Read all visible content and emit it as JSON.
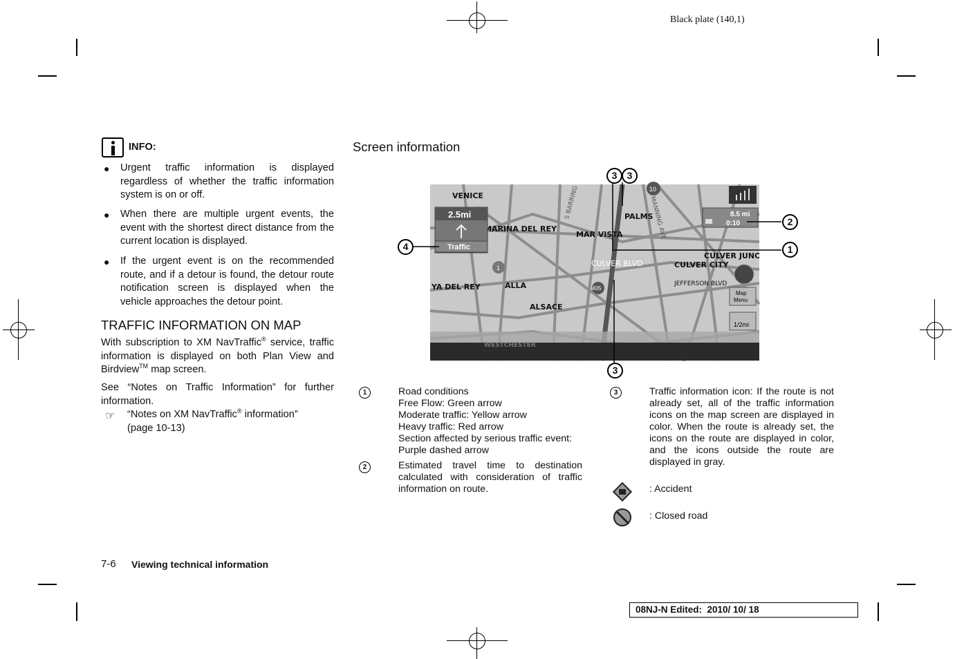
{
  "header": {
    "plate": "Black plate (140,1)"
  },
  "info": {
    "label": "INFO:",
    "bullets": [
      "Urgent traffic information is displayed regardless of whether the traffic information system is on or off.",
      "When there are multiple urgent events, the event with the shortest direct distance from the current location is displayed.",
      "If the urgent event is on the recommended route, and if a detour is found, the detour route notification screen is displayed when the vehicle approaches the detour point."
    ]
  },
  "traffic_section": {
    "heading": "TRAFFIC INFORMATION ON MAP",
    "para1_a": "With subscription to XM NavTraffic",
    "para1_reg": "®",
    "para1_b": " service, traffic information is displayed on both Plan View and Birdview",
    "para1_tm": "TM",
    "para1_c": " map screen.",
    "para2": "See “Notes on Traffic Information” for further information.",
    "ref_a": "“Notes on XM NavTraffic",
    "ref_reg": "®",
    "ref_b": " information”",
    "ref_page": "(page 10-13)"
  },
  "screen_info": {
    "heading": "Screen information",
    "map": {
      "places": [
        "VENICE",
        "MARINA DEL REY",
        "MAR VISTA",
        "PALMS",
        "CULVER BLVD",
        "CULVER JUNC",
        "CULVER CITY",
        "JEFFERSON BLVD",
        "YA DEL REY",
        "ALLA",
        "ALSACE",
        "WESTCHESTER",
        "MANNING AVE",
        "S BARRING"
      ],
      "shields": [
        "10",
        "1",
        "405"
      ],
      "distance_box": "2.5mi",
      "traffic_button": "Traffic",
      "dest_distance": "8.5 mi",
      "dest_time": "0:10",
      "map_menu_line1": "Map",
      "map_menu_line2": "Menu",
      "scale": "1/2mi",
      "callouts": [
        "1",
        "2",
        "3",
        "4"
      ]
    },
    "legend": [
      {
        "num": "1",
        "lines": [
          "Road conditions",
          "Free Flow: Green arrow",
          "Moderate traffic: Yellow arrow",
          "Heavy traffic: Red arrow",
          "Section affected by serious traffic event:",
          "Purple dashed arrow"
        ]
      },
      {
        "num": "2",
        "text": "Estimated travel time to destination calculated with consideration of traffic information on route."
      },
      {
        "num": "3",
        "text": "Traffic information icon: If the route is not already set, all of the traffic information icons on the map screen are displayed in color. When the route is already set, the icons on the route are displayed in color, and the icons outside the route are displayed in gray."
      }
    ],
    "icons": [
      {
        "icon": "accident-icon",
        "label": ": Accident"
      },
      {
        "icon": "closed-road-icon",
        "label": ": Closed road"
      }
    ]
  },
  "footer": {
    "page": "7-6",
    "section": "Viewing technical information",
    "edited": "08NJ-N Edited:  2010/ 10/ 18"
  }
}
